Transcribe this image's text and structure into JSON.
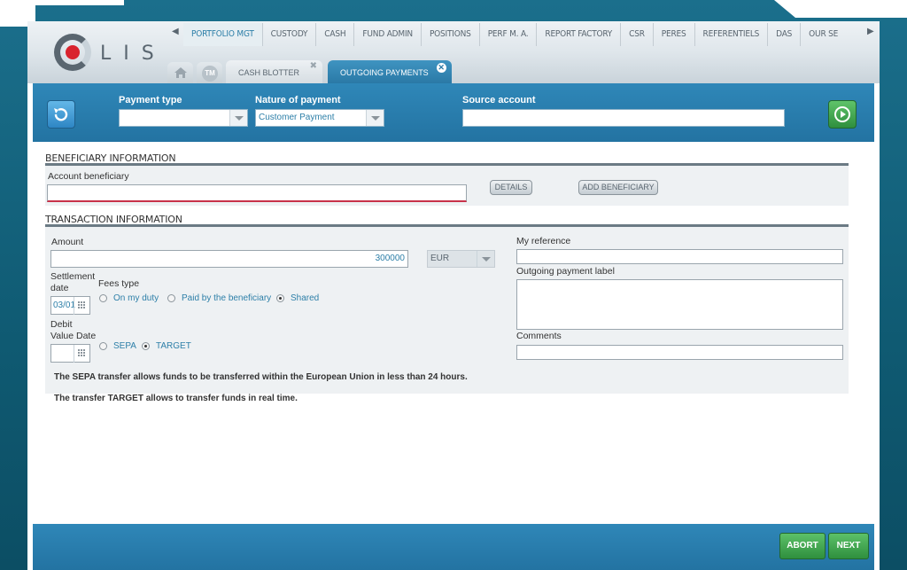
{
  "app": {
    "logo_text": "LIS"
  },
  "nav": {
    "tabs": [
      "PORTFOLIO MGT",
      "CUSTODY",
      "CASH",
      "FUND ADMIN",
      "POSITIONS",
      "PERF M. A.",
      "REPORT FACTORY",
      "CSR",
      "PERES",
      "REFERENTIELS",
      "DAS",
      "OUR SE"
    ],
    "active_index": 0
  },
  "subtabs": {
    "home_icon": "home-icon",
    "tm_label": "TM",
    "items": [
      {
        "label": "CASH BLOTTER",
        "active": false
      },
      {
        "label": "OUTGOING PAYMENTS",
        "active": true
      }
    ]
  },
  "toolbar": {
    "payment_type_label": "Payment type",
    "payment_type_value": "",
    "nature_label": "Nature of payment",
    "nature_value": "Customer Payment",
    "source_account_label": "Source account",
    "source_account_value": ""
  },
  "beneficiary": {
    "section_title": "BENEFICIARY INFORMATION",
    "account_label": "Account beneficiary",
    "account_value": "",
    "details_button": "DETAILS",
    "add_button": "ADD BENEFICIARY"
  },
  "transaction": {
    "section_title": "TRANSACTION INFORMATION",
    "amount_label": "Amount",
    "amount_value": "300000",
    "currency_value": "EUR",
    "settlement_label_1": "Settlement",
    "settlement_label_2": "date",
    "settlement_value": "03/01",
    "fees_label": "Fees type",
    "fees_options": [
      "On my duty",
      "Paid by the beneficiary",
      "Shared"
    ],
    "fees_selected": 2,
    "debit_label_1": "Debit",
    "debit_label_2": "Value Date",
    "debit_value": "",
    "transfer_options": [
      "SEPA",
      "TARGET"
    ],
    "transfer_selected": 1,
    "my_reference_label": "My reference",
    "outgoing_label_label": "Outgoing payment label",
    "comments_label": "Comments",
    "info_sepa": "The SEPA transfer allows funds to be transferred within the European Union in less than 24 hours.",
    "info_target": "The transfer TARGET allows to transfer funds in real time."
  },
  "footer": {
    "abort": "ABORT",
    "next": "NEXT"
  }
}
